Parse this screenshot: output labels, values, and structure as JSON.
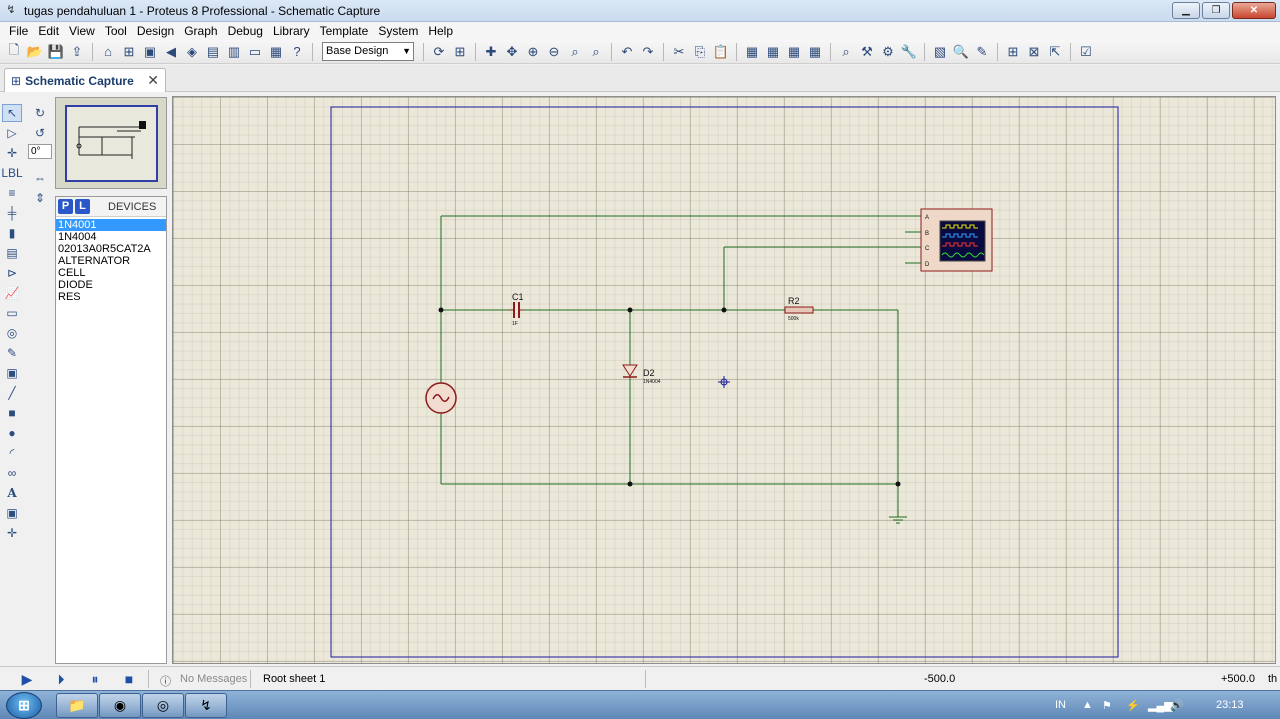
{
  "window": {
    "title": "tugas pendahuluan 1 - Proteus 8 Professional - Schematic Capture",
    "controls": {
      "minimize": "▁",
      "maximize": "❐",
      "close": "✕"
    }
  },
  "menu": [
    "File",
    "Edit",
    "View",
    "Tool",
    "Design",
    "Graph",
    "Debug",
    "Library",
    "Template",
    "System",
    "Help"
  ],
  "toolbar": {
    "design_select": "Base Design"
  },
  "tab": {
    "label": "Schematic Capture",
    "close": "✕"
  },
  "rotation": {
    "angle": "0°"
  },
  "devices": {
    "p_label": "P",
    "l_label": "L",
    "title": "DEVICES",
    "items": [
      "1N4001",
      "1N4004",
      "02013A0R5CAT2A",
      "ALTERNATOR",
      "CELL",
      "DIODE",
      "RES"
    ],
    "selected": "1N4001"
  },
  "schematic": {
    "c1_label": "C1",
    "c1_value": "1F",
    "r2_label": "R2",
    "r2_value": "500k",
    "d2_label": "D2",
    "d2_value": "1N4004",
    "scope_channels": [
      "A",
      "B",
      "C",
      "D"
    ]
  },
  "status": {
    "messages": "No Messages",
    "sheet": "Root sheet 1",
    "coord_x": "-500.0",
    "coord_y": "+500.0",
    "unit": "th"
  },
  "taskbar": {
    "language": "IN",
    "time": "23:13"
  },
  "colors": {
    "wire": "#1f6b1f",
    "component": "#8b1a1a",
    "frame": "#1a1aa0",
    "canvas": "#ebe8d9"
  }
}
